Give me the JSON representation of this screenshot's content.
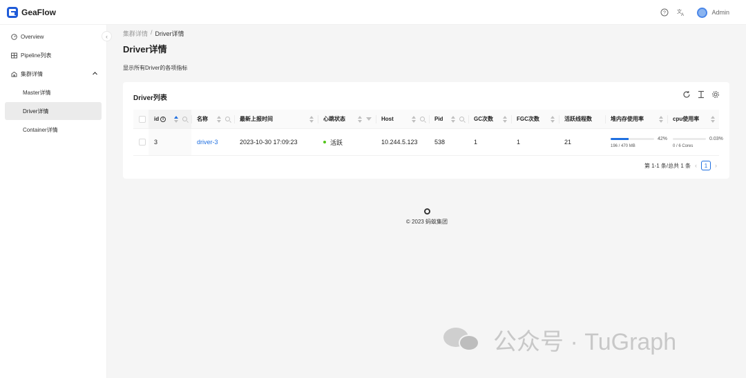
{
  "app": {
    "name": "GeaFlow"
  },
  "header": {
    "user": "Admin",
    "help_icon": "help-icon",
    "lang_icon": "translate-icon"
  },
  "sidebar": {
    "items": [
      {
        "label": "Overview",
        "icon": "dashboard-icon"
      },
      {
        "label": "Pipeline列表",
        "icon": "table-icon"
      },
      {
        "label": "集群详情",
        "icon": "cluster-icon",
        "expanded": true
      },
      {
        "label": "Master详情"
      },
      {
        "label": "Driver详情",
        "active": true
      },
      {
        "label": "Container详情"
      }
    ]
  },
  "breadcrumb": {
    "parent": "集群详情",
    "separator": "/",
    "current": "Driver详情"
  },
  "page": {
    "title": "Driver详情",
    "description": "显示所有Driver的各项指标"
  },
  "table": {
    "title": "Driver列表",
    "columns": [
      "id",
      "名称",
      "最新上报时间",
      "心跳状态",
      "Host",
      "Pid",
      "GC次数",
      "FGC次数",
      "活跃线程数",
      "堆内存使用率",
      "cpu使用率"
    ],
    "rows": [
      {
        "id": "3",
        "name": "driver-3",
        "last_report": "2023-10-30 17:09:23",
        "heartbeat": "活跃",
        "host": "10.244.5.123",
        "pid": "538",
        "gc": "1",
        "fgc": "1",
        "threads": "21",
        "heap_pct_label": "42%",
        "heap_pct": 0.42,
        "heap_detail": "196 / 470 MB",
        "cpu_pct_label": "0.03%",
        "cpu_pct": 0.0003,
        "cpu_detail": "0 / 6 Cores"
      }
    ],
    "pagination": {
      "summary": "第 1-1 条/总共 1 条",
      "current": "1"
    }
  },
  "colors": {
    "accent": "#1f6fe0",
    "active_status": "#52c41a"
  },
  "footer": {
    "copyright": "© 2023 蚂蚁集团"
  },
  "watermark": {
    "text": "公众号 · TuGraph"
  }
}
